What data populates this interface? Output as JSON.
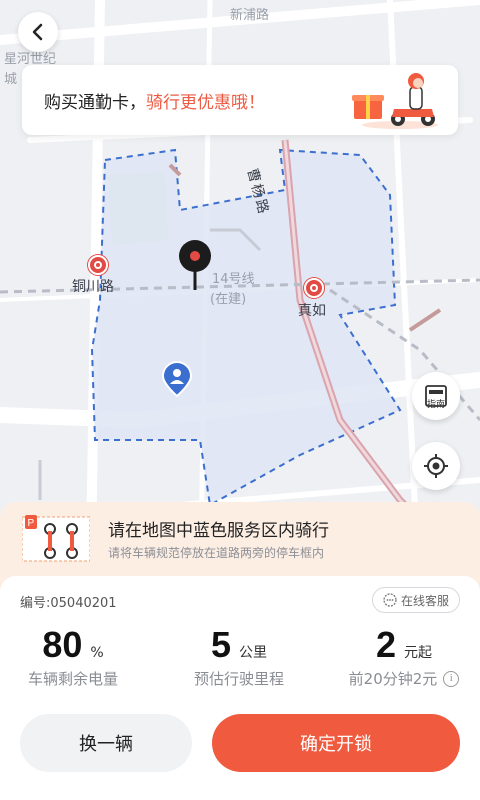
{
  "map": {
    "labels": {
      "top_left_1": "星河世纪",
      "top_left_2": "城",
      "top_road": "新浦路",
      "road_caoyang": "曹杨路",
      "metro_tongchuan": "铜川路",
      "metro_zhenru": "真如",
      "line14": "14号线",
      "line14_status": "(在建)"
    },
    "guide_label": "指南",
    "colors": {
      "service_area": "#dfe5f5",
      "service_border": "#3a6fd0",
      "metro": "#e24b43",
      "pin": "#1c1c1c",
      "user": "#3a6fd0"
    }
  },
  "promo": {
    "text_plain": "购买通勤卡，",
    "text_highlight": "骑行更优惠哦！"
  },
  "banner": {
    "title": "请在地图中蓝色服务区内骑行",
    "subtitle": "请将车辆规范停放在道路两旁的停车框内"
  },
  "bike": {
    "id_text": "编号:05040201",
    "service_label": "在线客服"
  },
  "stats": [
    {
      "value": "80",
      "unit": "%",
      "label": "车辆剩余电量"
    },
    {
      "value": "5",
      "unit": "公里",
      "label": "预估行驶里程"
    },
    {
      "value": "2",
      "unit": "元起",
      "label": "前20分钟2元"
    }
  ],
  "actions": {
    "switch_label": "换一辆",
    "unlock_label": "确定开锁"
  },
  "accent_color": "#f05a3e"
}
